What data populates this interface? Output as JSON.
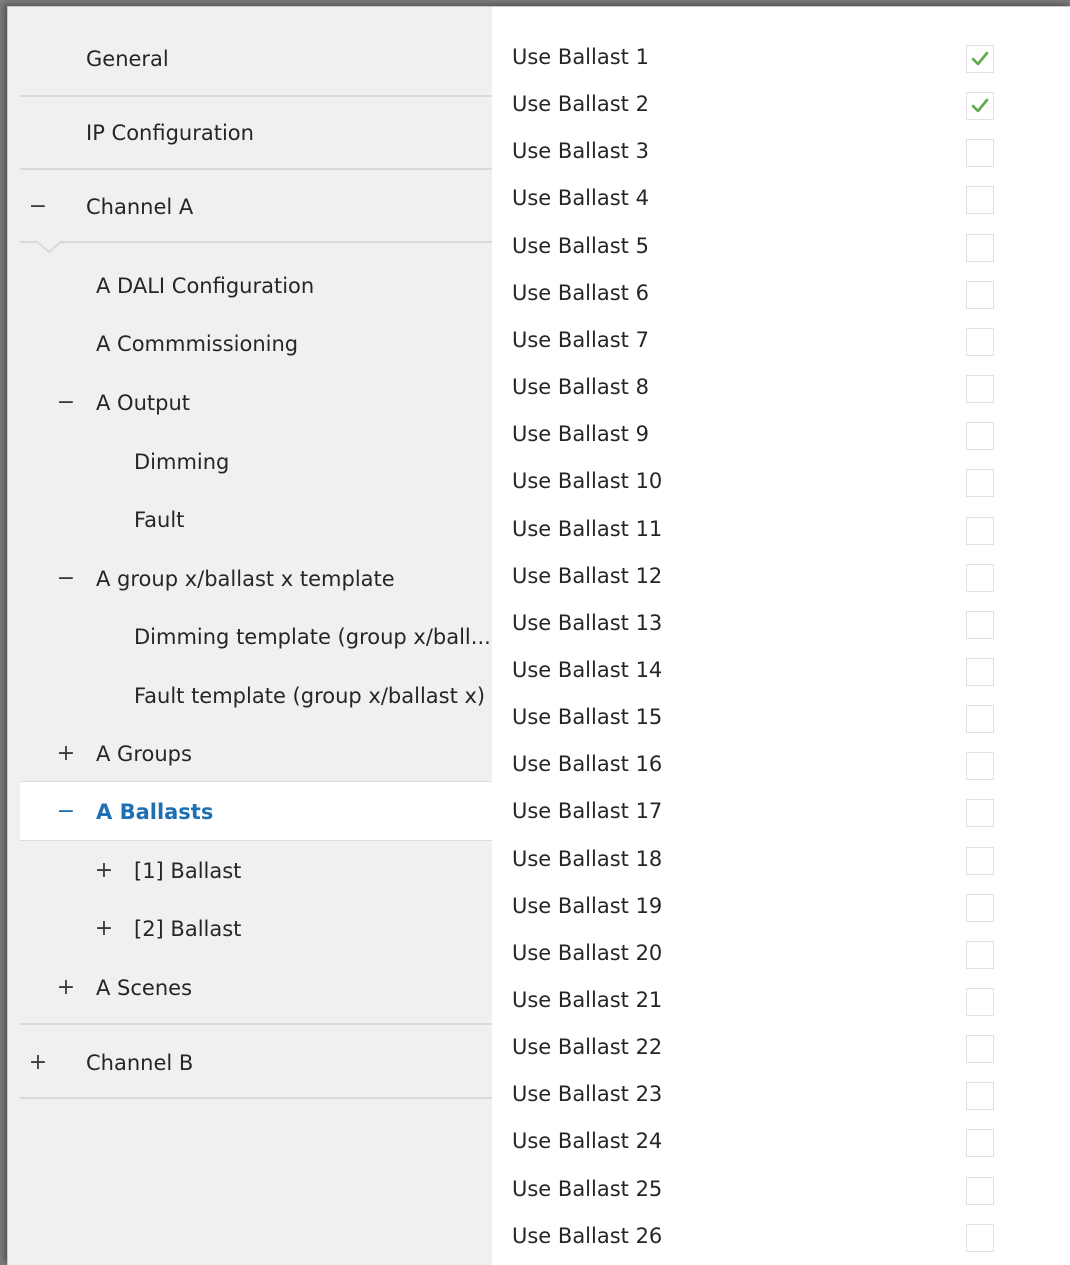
{
  "sidebar": {
    "items": [
      {
        "label": "General",
        "expander": ""
      },
      {
        "label": "IP Configuration",
        "expander": ""
      },
      {
        "label": "Channel A",
        "expander": "−"
      },
      {
        "label": "A DALI Configuration",
        "expander": ""
      },
      {
        "label": "A Commmissioning",
        "expander": ""
      },
      {
        "label": "A Output",
        "expander": "−"
      },
      {
        "label": "Dimming",
        "expander": ""
      },
      {
        "label": "Fault",
        "expander": ""
      },
      {
        "label": "A group x/ballast x template",
        "expander": "−"
      },
      {
        "label": "Dimming template (group x/ball...",
        "expander": ""
      },
      {
        "label": "Fault template  (group x/ballast x)",
        "expander": ""
      },
      {
        "label": "A Groups",
        "expander": "+"
      },
      {
        "label": "A Ballasts",
        "expander": "−",
        "selected": true
      },
      {
        "label": "[1] Ballast",
        "expander": "+"
      },
      {
        "label": "[2] Ballast",
        "expander": "+"
      },
      {
        "label": "A Scenes",
        "expander": "+"
      },
      {
        "label": "Channel B",
        "expander": "+"
      }
    ]
  },
  "main": {
    "rows": [
      {
        "label": "Use Ballast 1",
        "checked": true
      },
      {
        "label": "Use Ballast 2",
        "checked": true
      },
      {
        "label": "Use Ballast 3",
        "checked": false
      },
      {
        "label": "Use Ballast 4",
        "checked": false
      },
      {
        "label": "Use Ballast 5",
        "checked": false
      },
      {
        "label": "Use Ballast 6",
        "checked": false
      },
      {
        "label": "Use Ballast 7",
        "checked": false
      },
      {
        "label": "Use Ballast 8",
        "checked": false
      },
      {
        "label": "Use Ballast 9",
        "checked": false
      },
      {
        "label": "Use Ballast 10",
        "checked": false
      },
      {
        "label": "Use Ballast 11",
        "checked": false
      },
      {
        "label": "Use Ballast 12",
        "checked": false
      },
      {
        "label": "Use Ballast 13",
        "checked": false
      },
      {
        "label": "Use Ballast 14",
        "checked": false
      },
      {
        "label": "Use Ballast 15",
        "checked": false
      },
      {
        "label": "Use Ballast 16",
        "checked": false
      },
      {
        "label": "Use Ballast 17",
        "checked": false
      },
      {
        "label": "Use Ballast 18",
        "checked": false
      },
      {
        "label": "Use Ballast 19",
        "checked": false
      },
      {
        "label": "Use Ballast 20",
        "checked": false
      },
      {
        "label": "Use Ballast 21",
        "checked": false
      },
      {
        "label": "Use Ballast 22",
        "checked": false
      },
      {
        "label": "Use Ballast 23",
        "checked": false
      },
      {
        "label": "Use Ballast 24",
        "checked": false
      },
      {
        "label": "Use Ballast 25",
        "checked": false
      },
      {
        "label": "Use Ballast 26",
        "checked": false
      }
    ]
  },
  "colors": {
    "sidebar_bg": "#f0f0f0",
    "selected_text": "#1f6fb5",
    "checkmark": "#5fa84b",
    "text": "#262626"
  },
  "icons": {
    "checked": "checkmark-icon",
    "collapse": "minus-icon",
    "expand": "plus-icon"
  }
}
